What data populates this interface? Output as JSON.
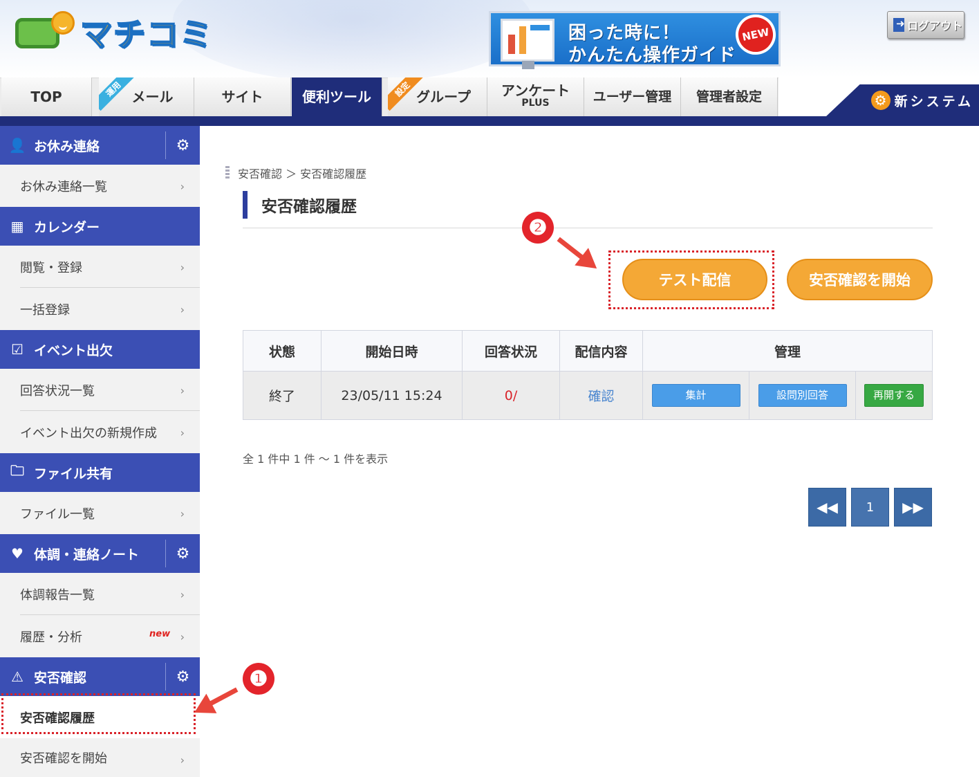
{
  "header": {
    "logo_text": "マチコミ",
    "guide_line1": "困った時に！",
    "guide_line2": "かんたん操作ガイド",
    "guide_badge": "NEW",
    "logout_label": "ログアウト"
  },
  "nav": {
    "tabs": [
      {
        "label": "TOP"
      },
      {
        "label": "メール",
        "ribbon": "運用"
      },
      {
        "label": "サイト"
      },
      {
        "label": "便利ツール"
      },
      {
        "label": "グループ",
        "ribbon": "設定"
      },
      {
        "label": "アンケート",
        "sub": "PLUS"
      },
      {
        "label": "ユーザー管理"
      },
      {
        "label": "管理者設定"
      }
    ],
    "new_system": "新システム"
  },
  "sidebar": {
    "sections": [
      {
        "label": "お休み連絡",
        "icon": "person-icon",
        "items": [
          "お休み連絡一覧"
        ]
      },
      {
        "label": "カレンダー",
        "icon": "calendar-icon",
        "items": [
          "閲覧・登録",
          "一括登録"
        ]
      },
      {
        "label": "イベント出欠",
        "icon": "calendar-check-icon",
        "items": [
          "回答状況一覧",
          "イベント出欠の新規作成"
        ]
      },
      {
        "label": "ファイル共有",
        "icon": "folder-icon",
        "items": [
          "ファイル一覧"
        ]
      },
      {
        "label": "体調・連絡ノート",
        "icon": "heartbeat-icon",
        "items": [
          "体調報告一覧",
          "履歴・分析"
        ]
      },
      {
        "label": "安否確認",
        "icon": "warning-icon",
        "items": [
          "安否確認履歴",
          "安否確認を開始"
        ]
      }
    ],
    "new_tag": "new"
  },
  "main": {
    "breadcrumb": "安否確認 ＞ 安否確認履歴",
    "title": "安否確認履歴",
    "test_button": "テスト配信",
    "start_button": "安否確認を開始",
    "table": {
      "headers": [
        "状態",
        "開始日時",
        "回答状況",
        "配信内容",
        "管理"
      ],
      "rows": [
        {
          "status": "終了",
          "start": "23/05/11 15:24",
          "answer": "0/",
          "content": "確認",
          "actions": [
            "集計",
            "設問別回答",
            "再開する"
          ]
        }
      ]
    },
    "count_text": "全 1 件中 1 件 ～ 1 件を表示",
    "pagination": {
      "current": "1"
    }
  },
  "annotations": {
    "badge1": "❶",
    "badge2": "❷",
    "color": "#e3242b"
  }
}
